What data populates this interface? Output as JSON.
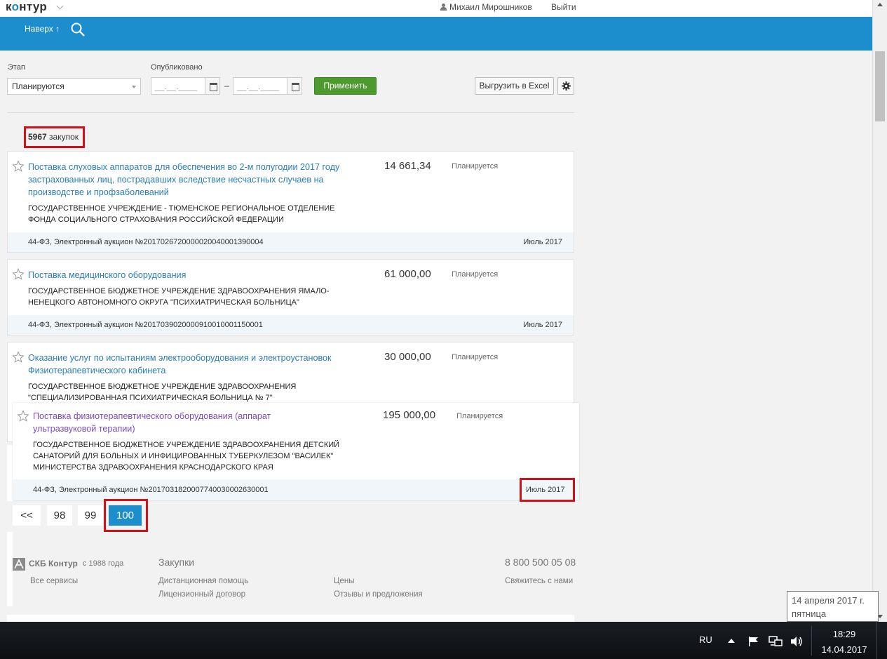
{
  "header": {
    "logo_prefix": "к",
    "logo_o": "о",
    "logo_suffix": "нтур",
    "user_name": "Михаил Мирошников",
    "logout_label": "Выйти"
  },
  "nav": {
    "up_label": "Наверх ↑"
  },
  "filters": {
    "stage_label": "Этап",
    "stage_value": "Планируются",
    "published_label": "Опубликовано",
    "date_from_placeholder": "__.__.____",
    "date_to_placeholder": "__.__.____",
    "date_separator": "–",
    "apply_label": "Применить",
    "export_label": "Выгрузить в Excel"
  },
  "results": {
    "count_number": "5967",
    "count_unit": "закупок"
  },
  "cards": [
    {
      "title": "Поставка слуховых аппаратов для обеспечения во 2-м полугодии 2017 году застрахованных лиц, пострадавших вследствие несчастных случаев на производстве и профзаболеваний",
      "price": "14 661,34",
      "status": "Планируется",
      "org": "ГОСУДАРСТВЕННОЕ УЧРЕЖДЕНИЕ - ТЮМЕНСКОЕ РЕГИОНАЛЬНОЕ ОТДЕЛЕНИЕ ФОНДА СОЦИАЛЬНОГО СТРАХОВАНИЯ РОССИЙСКОЙ ФЕДЕРАЦИИ",
      "law": "44-ФЗ, Электронный аукцион №2017026720000020040001390004",
      "month": "Июль 2017"
    },
    {
      "title": "Поставка медицинского оборудования",
      "price": "61 000,00",
      "status": "Планируется",
      "org": "ГОСУДАРСТВЕННОЕ БЮДЖЕТНОЕ УЧРЕЖДЕНИЕ ЗДРАВООХРАНЕНИЯ ЯМАЛО-НЕНЕЦКОГО АВТОНОМНОГО ОКРУГА \"ПСИХИАТРИЧЕСКАЯ БОЛЬНИЦА\"",
      "law": "44-ФЗ, Электронный аукцион №2017039020000910010001150001",
      "month": "Июль 2017"
    },
    {
      "title": "Оказание услуг по испытаниям электрооборудования и электроустановок Физиотерапевтического кабинета",
      "price": "30 000,00",
      "status": "Планируется",
      "org": "ГОСУДАРСТВЕННОЕ БЮДЖЕТНОЕ УЧРЕЖДЕНИЕ ЗДРАВООХРАНЕНИЯ \"СПЕЦИАЛИЗИРОВАННАЯ ПСИХИАТРИЧЕСКАЯ БОЛЬНИЦА № 7\""
    }
  ],
  "popup_card": {
    "title": "Поставка физиотерапевтического оборудования (аппарат ультразвуковой терапии)",
    "price": "195 000,00",
    "status": "Планируется",
    "org": "ГОСУДАРСТВЕННОЕ БЮДЖЕТНОЕ УЧРЕЖДЕНИЕ ЗДРАВООХРАНЕНИЯ ДЕТСКИЙ САНАТОРИЙ ДЛЯ БОЛЬНЫХ И ИНФИЦИРОВАННЫХ ТУБЕРКУЛЕЗОМ \"ВАСИЛЕК\" МИНИСТЕРСТВА ЗДРАВООХРАНЕНИЯ КРАСНОДАРСКОГО КРАЯ",
    "law": "44-ФЗ, Электронный аукцион №2017031820007740030002630001",
    "month": "Июль 2017"
  },
  "pagination": {
    "prev": "<<",
    "pages": [
      "98",
      "99",
      "100"
    ],
    "current": "100"
  },
  "footer": {
    "brand": "СКБ Контур",
    "since": "с 1988 года",
    "section_title": "Закупки",
    "phone": "8 800 500 05 08",
    "all_services": "Все сервисы",
    "remote_help": "Дистанционная помощь",
    "license": "Лицензионный договор",
    "prices": "Цены",
    "feedback": "Отзывы и предложения",
    "contact": "Свяжитесь с нами"
  },
  "tooltip": {
    "date": "14 апреля 2017 г.",
    "weekday": "пятница"
  },
  "taskbar": {
    "lang": "RU",
    "time": "18:29",
    "date": "14.04.2017"
  },
  "colors": {
    "brand_blue": "#1c8ecd",
    "link_blue": "#2a7db9",
    "visited_link": "#7b4bbd",
    "apply_green": "#4d9a2f",
    "highlight_red": "#d0121b"
  }
}
